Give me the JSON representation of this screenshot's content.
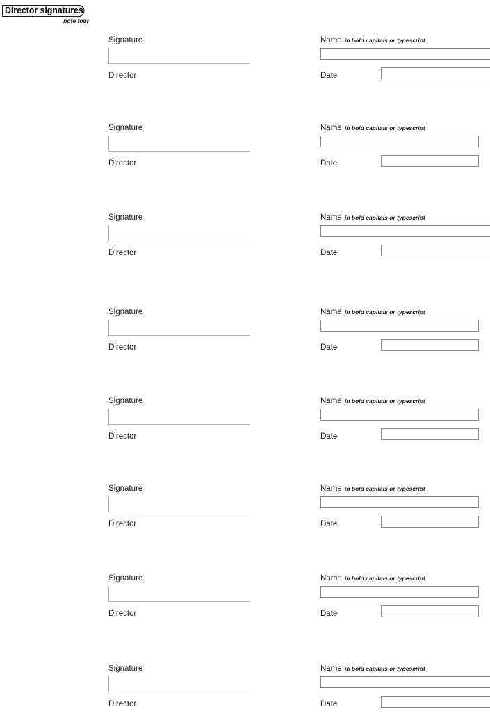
{
  "document": {
    "header": {
      "title": "Director signatures",
      "note": "note four"
    },
    "labels": {
      "signature": "Signature",
      "director": "Director",
      "name": "Name",
      "name_hint": "in bold capitals or typescript",
      "date": "Date"
    },
    "colors": {
      "page_background": "#ffffff",
      "text": "#1a1a1a",
      "signature_rule": "#b4b4b4",
      "field_border": "#8a8a8a"
    },
    "blocks": [
      {
        "signature": "Signature",
        "director": "Director",
        "name": "Name",
        "name_hint": "in bold capitals or typescript",
        "date": "Date",
        "signature_value": "",
        "name_value": "",
        "date_value": ""
      },
      {
        "signature": "Signature",
        "director": "Director",
        "name": "Name",
        "name_hint": "in bold capitals or typescript",
        "date": "Date",
        "signature_value": "",
        "name_value": "",
        "date_value": ""
      },
      {
        "signature": "Signature",
        "director": "Director",
        "name": "Name",
        "name_hint": "in bold capitals or typescript",
        "date": "Date",
        "signature_value": "",
        "name_value": "",
        "date_value": ""
      },
      {
        "signature": "Signature",
        "director": "Director",
        "name": "Name",
        "name_hint": "in bold capitals or typescript",
        "date": "Date",
        "signature_value": "",
        "name_value": "",
        "date_value": ""
      },
      {
        "signature": "Signature",
        "director": "Director",
        "name": "Name",
        "name_hint": "in bold capitals or typescript",
        "date": "Date",
        "signature_value": "",
        "name_value": "",
        "date_value": ""
      },
      {
        "signature": "Signature",
        "director": "Director",
        "name": "Name",
        "name_hint": "in bold capitals or typescript",
        "date": "Date",
        "signature_value": "",
        "name_value": "",
        "date_value": ""
      },
      {
        "signature": "Signature",
        "director": "Director",
        "name": "Name",
        "name_hint": "in bold capitals or typescript",
        "date": "Date",
        "signature_value": "",
        "name_value": "",
        "date_value": ""
      },
      {
        "signature": "Signature",
        "director": "Director",
        "name": "Name",
        "name_hint": "in bold capitals or typescript",
        "date": "Date",
        "signature_value": "",
        "name_value": "",
        "date_value": ""
      }
    ]
  },
  "layout": {
    "block_tops": [
      52,
      178,
      307,
      443,
      571,
      697,
      826,
      956
    ],
    "shifted_blocks": [
      0,
      2,
      7
    ]
  }
}
